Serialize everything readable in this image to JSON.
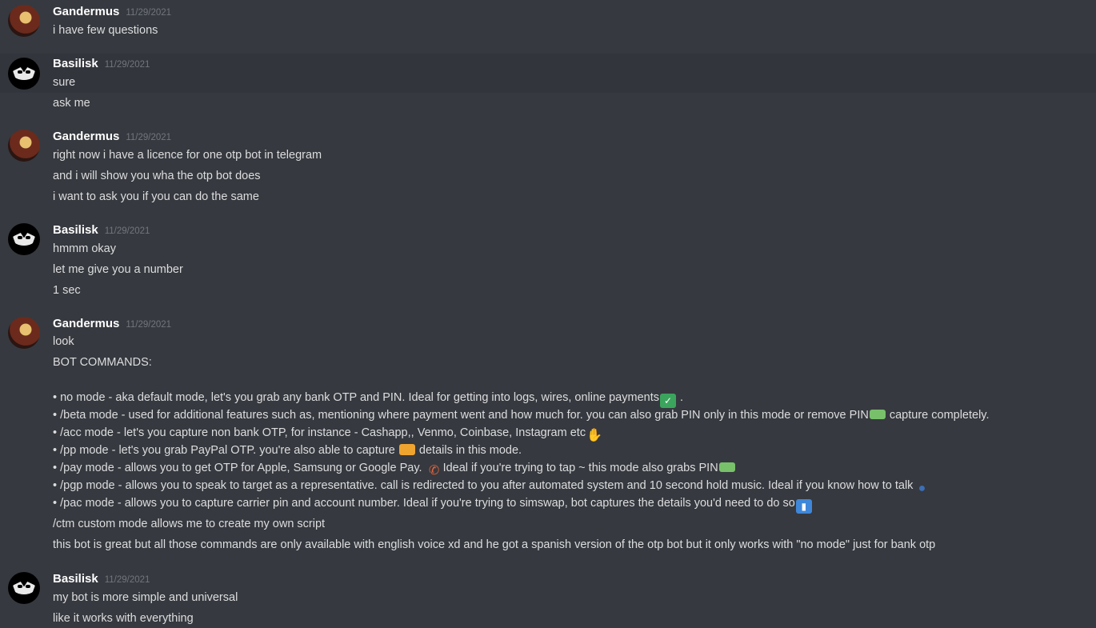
{
  "messages": [
    {
      "user": "Gandermus",
      "time": "11/29/2021",
      "avatar": "gandermus-avatar",
      "lines": [
        "i have few questions"
      ]
    },
    {
      "user": "Basilisk",
      "time": "11/29/2021",
      "avatar": "basilisk-avatar",
      "lines": [
        "sure",
        "ask me"
      ]
    },
    {
      "user": "Gandermus",
      "time": "11/29/2021",
      "avatar": "gandermus-avatar",
      "lines": [
        "right now i have a licence for one otp bot in telegram",
        "and i will show you wha the otp bot does",
        "i want to ask you if you can do the same"
      ]
    },
    {
      "user": "Basilisk",
      "time": "11/29/2021",
      "avatar": "basilisk-avatar",
      "lines": [
        "hmmm okay",
        "let me give you a number",
        "1 sec"
      ]
    },
    {
      "user": "Gandermus",
      "time": "11/29/2021",
      "avatar": "gandermus-avatar",
      "lines": [
        "look",
        "BOT COMMANDS:"
      ],
      "commands": [
        {
          "text": "• no mode - aka default mode, let's you grab any bank OTP and PIN. Ideal for getting into logs, wires, online payments",
          "emoji": "check-mark-icon",
          "after": " ."
        },
        {
          "text": "• /beta mode - used for additional features such as, mentioning where payment went and how much for. you can also grab PIN only in this mode or remove PIN",
          "emoji": "money-icon",
          "after": " capture completely."
        },
        {
          "text": "• /acc mode - let's you capture non bank OTP, for instance - Cashapp,, Venmo, Coinbase, Instagram etc",
          "emoji": "handshake-icon",
          "after": ""
        },
        {
          "text": "• /pp mode - let's you grab PayPal OTP. you're also able to capture ",
          "emoji": "credit-card-icon",
          "after": " details in this mode."
        },
        {
          "text": "• /pay mode - allows you to get OTP for Apple, Samsung or Google Pay. ",
          "emoji": "phone-icon",
          "after": "Ideal if you're trying to tap ~ this mode also grabs PIN",
          "emoji2": "money-icon"
        },
        {
          "text": "• /pgp mode - allows you to speak to target as a representative. call is redirected to you after automated system and 10 second hold music. Ideal if you know how to talk",
          "emoji": "speaking-head-icon",
          "after": ""
        },
        {
          "text": "• /pac mode - allows you to capture carrier pin and account number. Ideal if you're trying to simswap, bot captures the details you'd need to do so",
          "emoji": "signal-bars-icon",
          "after": ""
        }
      ],
      "tail": [
        "/ctm custom mode allows me to create my own script",
        "this bot is great but all those commands are only available with english voice xd and he got a spanish version of the otp bot but it only works with \"no mode\" just for bank otp"
      ]
    },
    {
      "user": "Basilisk",
      "time": "11/29/2021",
      "avatar": "basilisk-avatar",
      "lines": [
        "my bot is more simple and universal",
        "like it works with everything"
      ]
    }
  ],
  "colors": {
    "background": "#36393f",
    "highlight": "#32353b",
    "username": "#ffffff",
    "timestamp": "#72767d",
    "text": "#dcddde"
  }
}
